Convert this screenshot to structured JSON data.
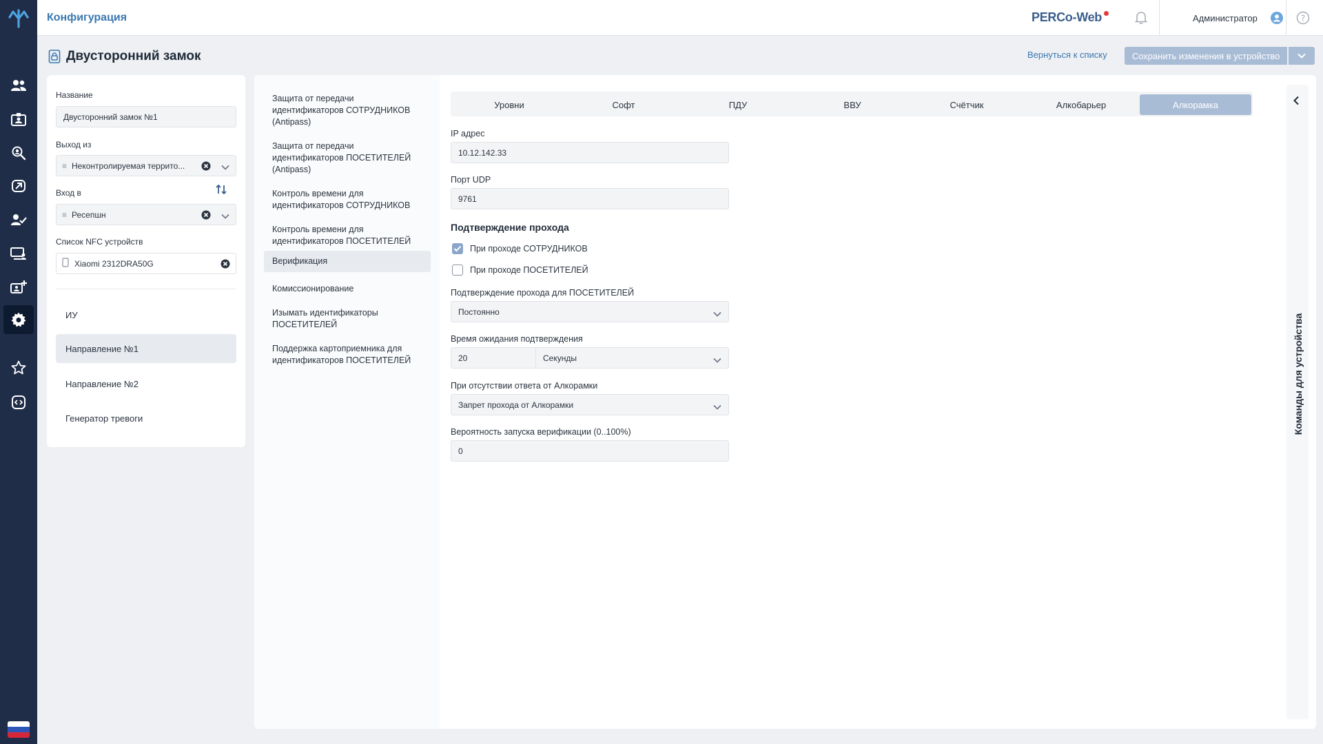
{
  "header": {
    "section_title": "Конфигурация",
    "brand": "PERCo-Web",
    "user_name": "Администратор"
  },
  "nav": {
    "items": [
      "users-icon",
      "badge-icon",
      "visitor-search-icon",
      "link-icon",
      "user-check-icon",
      "devices-icon",
      "add-card-icon",
      "gear-icon",
      "star-icon",
      "code-icon"
    ],
    "active": "gear-icon"
  },
  "page": {
    "title": "Двусторонний замок",
    "back_link": "Вернуться к списку",
    "save_button": "Сохранить изменения в устройство"
  },
  "left_panel": {
    "name_label": "Название",
    "name_value": "Двусторонний замок №1",
    "exit_label": "Выход из",
    "exit_value": "Неконтролируемая террито...",
    "entry_label": "Вход в",
    "entry_value": "Ресепшн",
    "nfc_label": "Список NFC устройств",
    "nfc_value": "Xiaomi 2312DRA50G",
    "tree": [
      "ИУ",
      "Направление №1",
      "Направление №2",
      "Генератор тревоги"
    ],
    "tree_selected": "Направление №1"
  },
  "sub_menu": {
    "items": [
      "Защита от передачи идентификаторов СОТРУДНИКОВ (Antipass)",
      "Защита от передачи идентификаторов ПОСЕТИТЕЛЕЙ (Antipass)",
      "Контроль времени для идентификаторов СОТРУДНИКОВ",
      "Контроль времени для идентификаторов ПОСЕТИТЕЛЕЙ",
      "Верификация",
      "Комиссионирование",
      "Изымать идентификаторы ПОСЕТИТЕЛЕЙ",
      "Поддержка картоприемника для идентификаторов ПОСЕТИТЕЛЕЙ"
    ],
    "selected": "Верификация"
  },
  "tabs": {
    "items": [
      "Уровни",
      "Софт",
      "ПДУ",
      "ВВУ",
      "Счётчик",
      "Алкобарьер",
      "Алкорамка"
    ],
    "active": "Алкорамка"
  },
  "form": {
    "ip_label": "IP адрес",
    "ip_value": "10.12.142.33",
    "udp_label": "Порт UDP",
    "udp_value": "9761",
    "confirm_section": "Подтверждение прохода",
    "cb_employees_label": "При проходе СОТРУДНИКОВ",
    "cb_employees_checked": true,
    "cb_visitors_label": "При проходе ПОСЕТИТЕЛЕЙ",
    "cb_visitors_checked": false,
    "visitor_confirm_label": "Подтверждение прохода для ПОСЕТИТЕЛЕЙ",
    "visitor_confirm_value": "Постоянно",
    "wait_label": "Время ожидания подтверждения",
    "wait_value": "20",
    "wait_unit": "Секунды",
    "no_response_label": "При отсутствии ответа от Алкорамки",
    "no_response_value": "Запрет прохода от Алкорамки",
    "probability_label": "Вероятность запуска верификации (0..100%)",
    "probability_value": "0"
  },
  "commands_panel": {
    "title": "Команды для устройства"
  },
  "colors": {
    "rail": "#1f2d49",
    "accent": "#3a78b0",
    "active_tab": "#a9bcd6",
    "brand_dot": "#e23b3b"
  }
}
